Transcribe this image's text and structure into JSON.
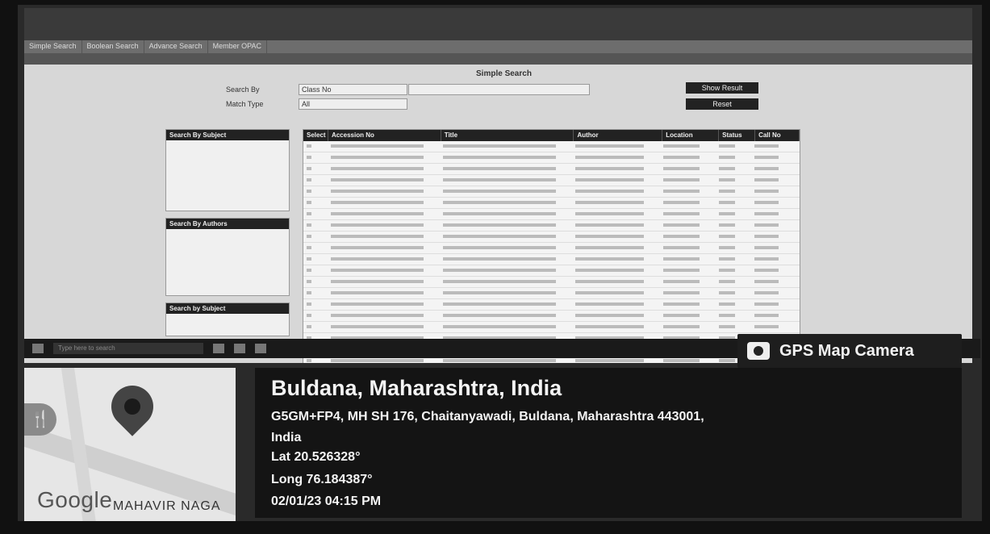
{
  "gps": {
    "badge": "GPS Map Camera",
    "place": "Buldana, Maharashtra, India",
    "address_line1": "G5GM+FP4, MH SH 176, Chaitanyawadi, Buldana, Maharashtra 443001,",
    "address_line2": "India",
    "lat": "Lat 20.526328°",
    "long": "Long 76.184387°",
    "timestamp": "02/01/23 04:15 PM"
  },
  "map": {
    "logo": "Google",
    "area_label": "MAHAVIR NAGA",
    "icons": [
      "restaurant-icon",
      "location-pin-icon"
    ]
  },
  "screen": {
    "tabs": [
      "Simple Search",
      "Boolean Search",
      "Advance Search",
      "Member OPAC"
    ],
    "page_title": "Simple Search",
    "search_by_label": "Search By",
    "search_by_value": "Class No",
    "match_type_label": "Match Type",
    "match_type_value": "All",
    "show_result": "Show Result",
    "reset": "Reset",
    "panel_subjects": "Search By Subject",
    "panel_authors": "Search By Authors",
    "panel_related": "Search by Subject",
    "columns": [
      "Select",
      "Accession No",
      "Title",
      "Author",
      "Location",
      "Status",
      "Call No"
    ],
    "taskbar_search": "Type here to search"
  }
}
